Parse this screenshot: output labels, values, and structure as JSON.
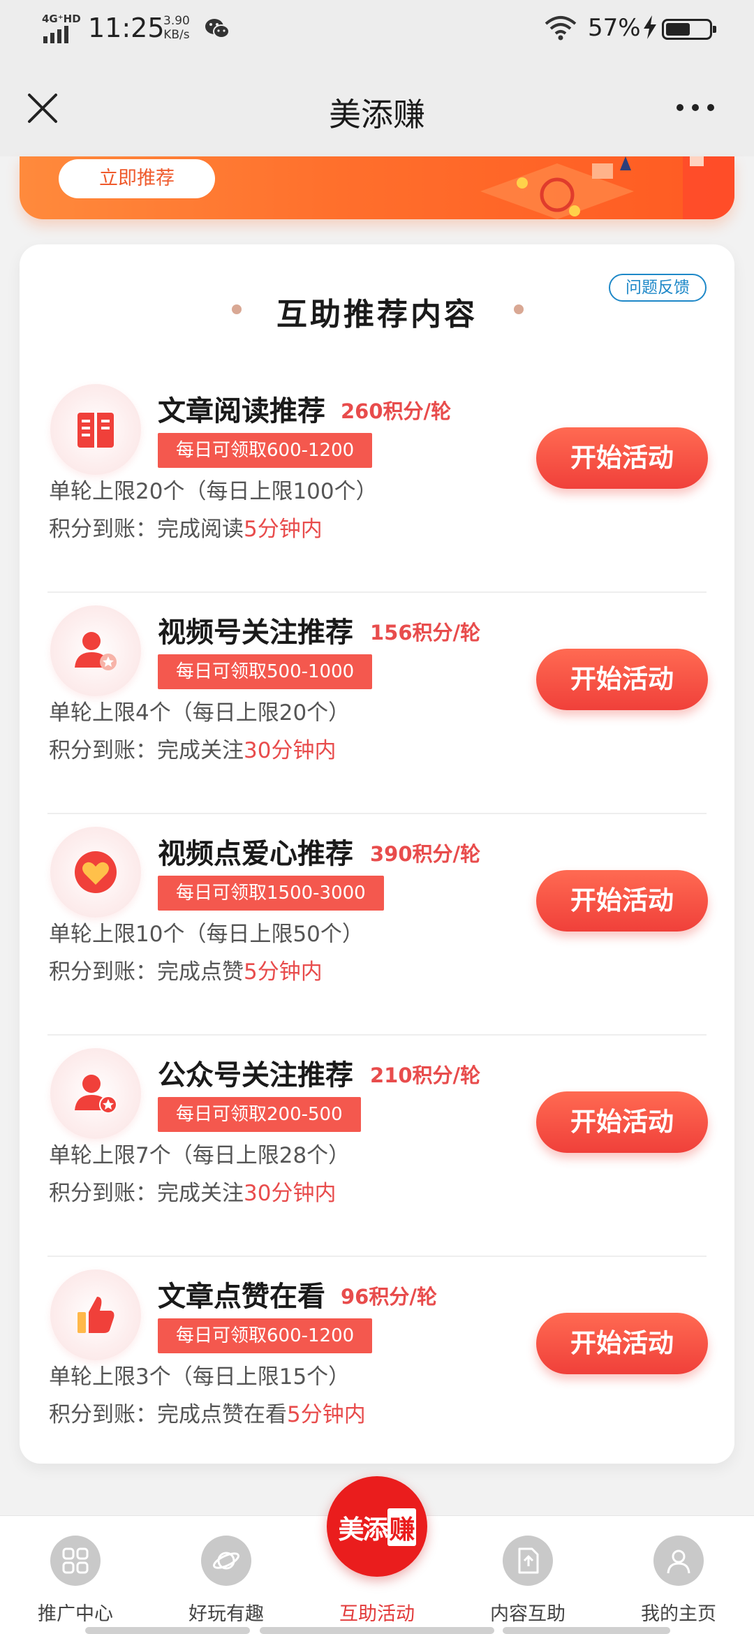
{
  "status_bar": {
    "network": "4G⁺HD",
    "time": "11:25",
    "speed_value": "3.90",
    "speed_unit": "KB/s",
    "battery_percent": "57%",
    "battery_level": 0.57
  },
  "header": {
    "title": "美添赚"
  },
  "banner": {
    "button_label": "立即推荐"
  },
  "section": {
    "title": "互助推荐内容",
    "feedback_label": "问题反馈"
  },
  "items": [
    {
      "name": "文章阅读推荐",
      "points": "260积分/轮",
      "badge": "每日可领取600-1200",
      "limit": "单轮上限20个（每日上限100个）",
      "arrival_prefix": "积分到账：完成阅读",
      "arrival_time": "5分钟内",
      "button": "开始活动",
      "icon": "book-icon"
    },
    {
      "name": "视频号关注推荐",
      "points": "156积分/轮",
      "badge": "每日可领取500-1000",
      "limit": "单轮上限4个（每日上限20个）",
      "arrival_prefix": "积分到账：完成关注",
      "arrival_time": "30分钟内",
      "button": "开始活动",
      "icon": "user-follow-icon"
    },
    {
      "name": "视频点爱心推荐",
      "points": "390积分/轮",
      "badge": "每日可领取1500-3000",
      "limit": "单轮上限10个（每日上限50个）",
      "arrival_prefix": "积分到账：完成点赞",
      "arrival_time": "5分钟内",
      "button": "开始活动",
      "icon": "heart-icon"
    },
    {
      "name": "公众号关注推荐",
      "points": "210积分/轮",
      "badge": "每日可领取200-500",
      "limit": "单轮上限7个（每日上限28个）",
      "arrival_prefix": "积分到账：完成关注",
      "arrival_time": "30分钟内",
      "button": "开始活动",
      "icon": "user-star-icon"
    },
    {
      "name": "文章点赞在看",
      "points": "96积分/轮",
      "badge": "每日可领取600-1200",
      "limit": "单轮上限3个（每日上限15个）",
      "arrival_prefix": "积分到账：完成点赞在看",
      "arrival_time": "5分钟内",
      "button": "开始活动",
      "icon": "thumbs-up-icon"
    }
  ],
  "bottom_nav": {
    "center_logo_a": "美添",
    "center_logo_b": "赚",
    "items": [
      {
        "label": "推广中心",
        "icon": "grid-icon"
      },
      {
        "label": "好玩有趣",
        "icon": "planet-icon"
      },
      {
        "label": "互助活动",
        "icon": "logo-icon",
        "active": true
      },
      {
        "label": "内容互助",
        "icon": "document-icon"
      },
      {
        "label": "我的主页",
        "icon": "profile-icon"
      }
    ]
  },
  "colors": {
    "accent": "#f0403a",
    "points_red": "#e84c4c",
    "link_blue": "#1e88c8",
    "banner_orange": "#ff6f2c"
  }
}
